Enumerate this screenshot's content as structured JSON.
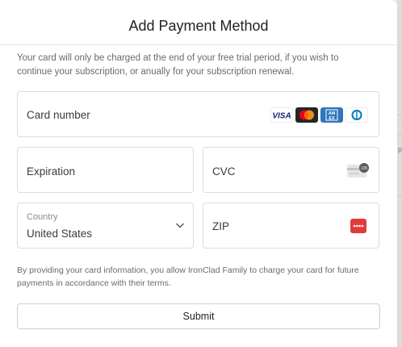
{
  "modal": {
    "title": "Add Payment Method",
    "intro": "Your card will only be charged at the end of your free trial period, if you wish to continue your subscription, or anually for your subscription renewal.",
    "disclaimer": "By providing your card information, you allow IronClad Family to charge your card for future payments in accordance with their terms."
  },
  "form": {
    "card_number_label": "Card number",
    "card_brands": [
      "visa-icon",
      "mastercard-icon",
      "amex-icon",
      "diners-icon"
    ],
    "expiration_label": "Expiration",
    "cvc_label": "CVC",
    "cvc_icon_text": "135",
    "country_label": "Country",
    "country_value": "United States",
    "zip_label": "ZIP",
    "submit_label": "Submit"
  },
  "colors": {
    "visa": "#1a1f71",
    "mastercard_red": "#eb001b",
    "mastercard_orange": "#f79e1b",
    "amex": "#2e77bc",
    "diners": "#0079be",
    "zip_icon": "#e03c3c"
  }
}
